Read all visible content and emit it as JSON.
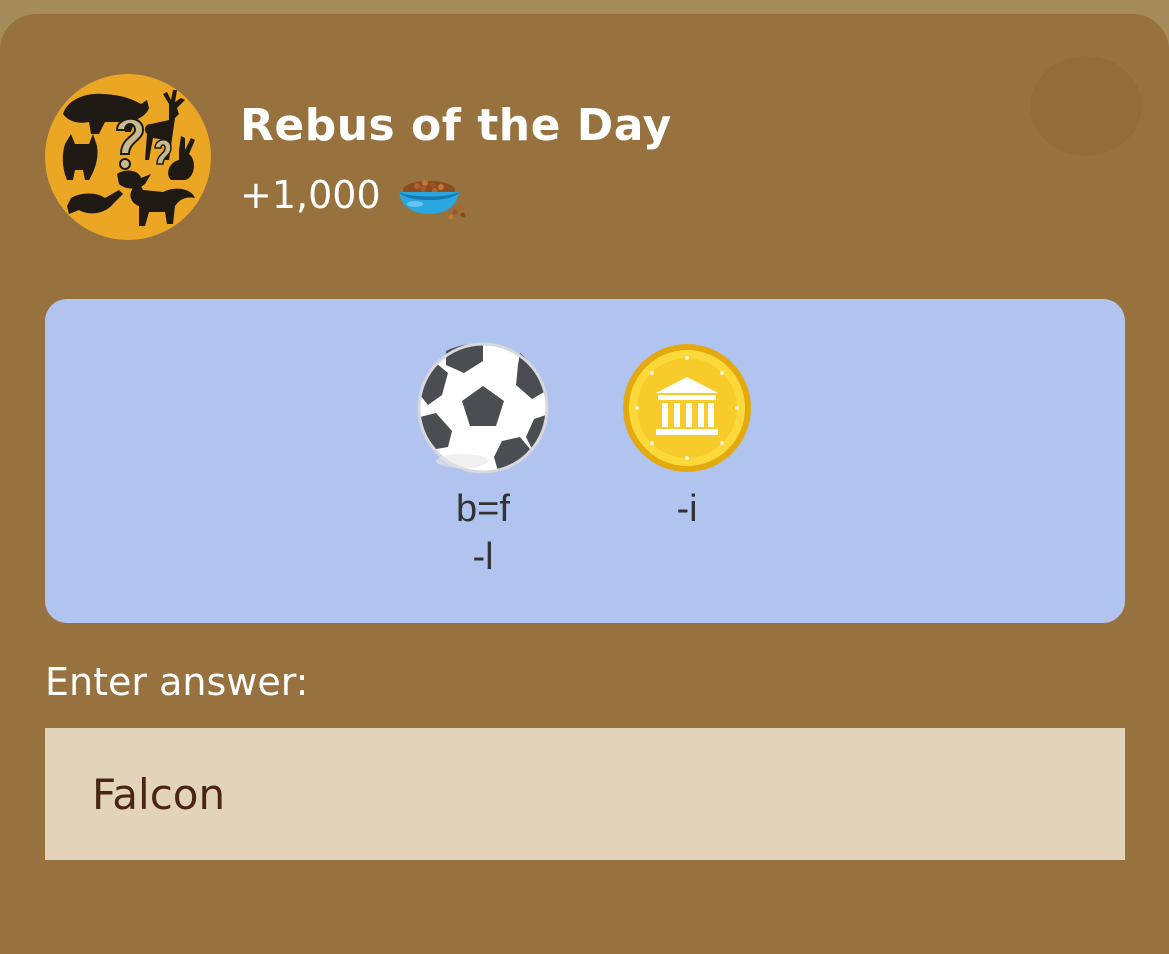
{
  "header": {
    "title": "Rebus of the Day",
    "reward_amount": "+1,000",
    "reward_icon": "pet-food-bowl-icon",
    "avatar_icon": "animal-silhouettes-question-icon"
  },
  "puzzle": {
    "items": [
      {
        "icon": "soccer-ball-icon",
        "hint": "b=f\n-l"
      },
      {
        "icon": "gold-coin-icon",
        "hint": "-i"
      }
    ]
  },
  "answer": {
    "label": "Enter answer:",
    "value": "Falcon"
  },
  "colors": {
    "page_background": "#98723e",
    "top_strip": "#a58c5a",
    "avatar_background": "#eba623",
    "puzzle_background": "#b0c4ef",
    "answer_field_background": "#e1d4ba",
    "answer_text": "#4a2414",
    "hint_text": "#333333"
  }
}
